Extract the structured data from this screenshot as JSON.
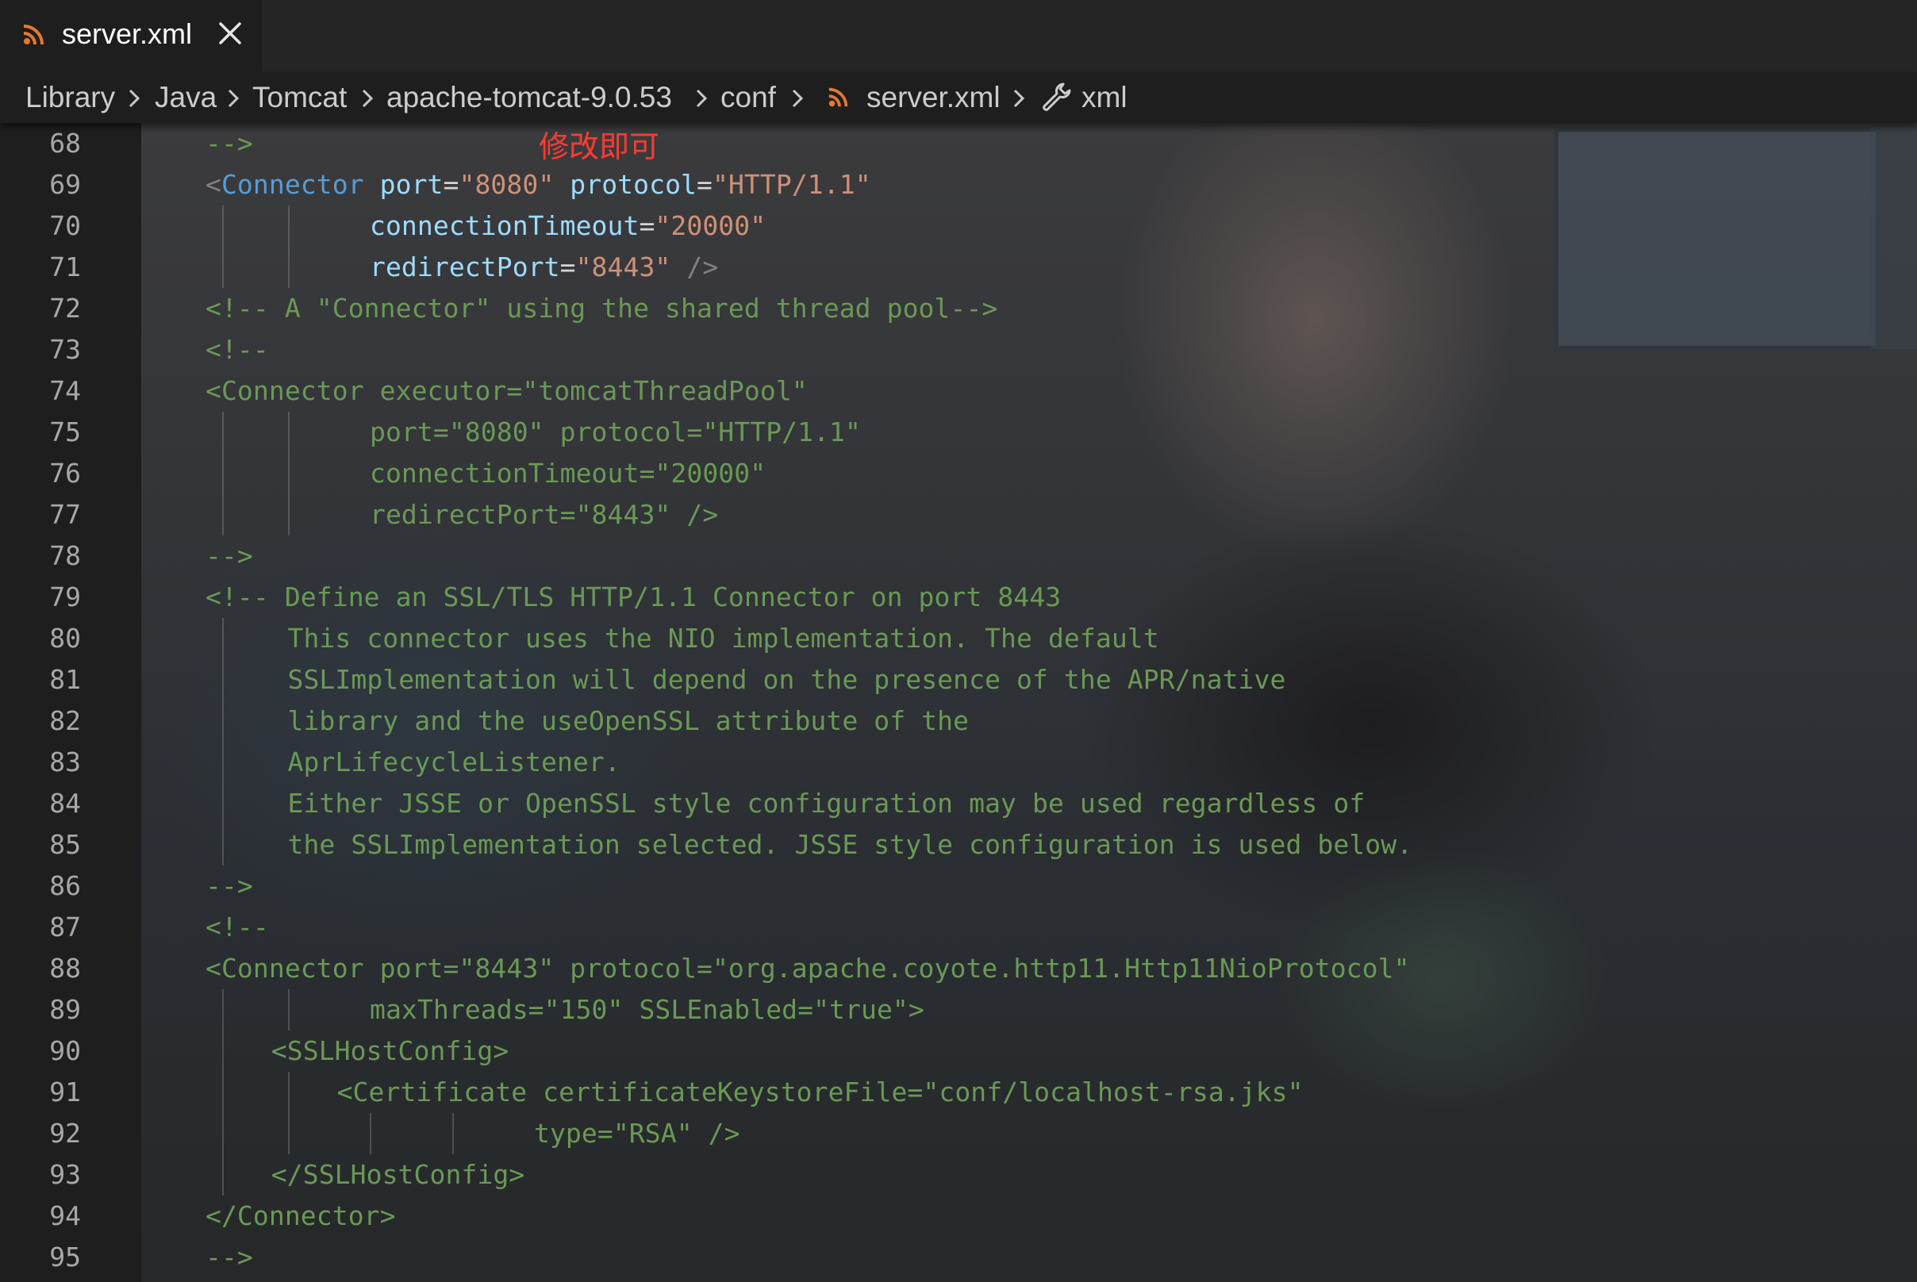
{
  "tab": {
    "label": "server.xml",
    "file_icon": "rss-icon",
    "close_icon": "close-icon",
    "icon_color": "#e37933"
  },
  "breadcrumb": {
    "items": [
      "Library",
      "Java",
      "Tomcat",
      "apache-tomcat-9.0.53",
      "conf",
      "server.xml",
      "xml"
    ],
    "separator_icon": "chevron-right-icon",
    "file_icon": "rss-icon",
    "symbol_icon": "wrench-icon"
  },
  "annotation": "修改即可",
  "lines": [
    {
      "n": "68",
      "text": "-->"
    },
    {
      "n": "69",
      "text": "<Connector port=\"8080\" protocol=\"HTTP/1.1\""
    },
    {
      "n": "70",
      "text": "connectionTimeout=\"20000\""
    },
    {
      "n": "71",
      "text": "redirectPort=\"8443\" />"
    },
    {
      "n": "72",
      "text": "<!-- A \"Connector\" using the shared thread pool-->"
    },
    {
      "n": "73",
      "text": "<!--"
    },
    {
      "n": "74",
      "text": "<Connector executor=\"tomcatThreadPool\""
    },
    {
      "n": "75",
      "text": "port=\"8080\" protocol=\"HTTP/1.1\""
    },
    {
      "n": "76",
      "text": "connectionTimeout=\"20000\""
    },
    {
      "n": "77",
      "text": "redirectPort=\"8443\" />"
    },
    {
      "n": "78",
      "text": "-->"
    },
    {
      "n": "79",
      "text": "<!-- Define an SSL/TLS HTTP/1.1 Connector on port 8443"
    },
    {
      "n": "80",
      "text": "This connector uses the NIO implementation. The default"
    },
    {
      "n": "81",
      "text": "SSLImplementation will depend on the presence of the APR/native"
    },
    {
      "n": "82",
      "text": "library and the useOpenSSL attribute of the"
    },
    {
      "n": "83",
      "text": "AprLifecycleListener."
    },
    {
      "n": "84",
      "text": "Either JSSE or OpenSSL style configuration may be used regardless of"
    },
    {
      "n": "85",
      "text": "the SSLImplementation selected. JSSE style configuration is used below."
    },
    {
      "n": "86",
      "text": "-->"
    },
    {
      "n": "87",
      "text": "<!--"
    },
    {
      "n": "88",
      "text": "<Connector port=\"8443\" protocol=\"org.apache.coyote.http11.Http11NioProtocol\""
    },
    {
      "n": "89",
      "text": "maxThreads=\"150\" SSLEnabled=\"true\">"
    },
    {
      "n": "90",
      "text": "<SSLHostConfig>"
    },
    {
      "n": "91",
      "text": "<Certificate certificateKeystoreFile=\"conf/localhost-rsa.jks\""
    },
    {
      "n": "92",
      "text": "type=\"RSA\" />"
    },
    {
      "n": "93",
      "text": "</SSLHostConfig>"
    },
    {
      "n": "94",
      "text": "</Connector>"
    },
    {
      "n": "95",
      "text": "-->"
    }
  ],
  "colors": {
    "comment": "#6a9955",
    "tag": "#569cd6",
    "attribute": "#9cdcfe",
    "string": "#ce9178",
    "annotation": "#ff3b30"
  }
}
